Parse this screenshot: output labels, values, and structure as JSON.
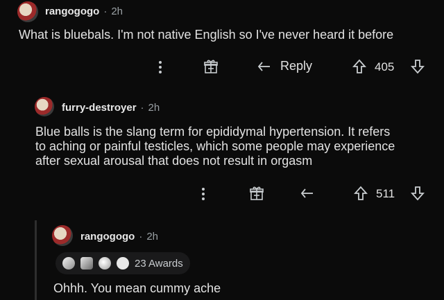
{
  "comments": [
    {
      "username": "rangogogo",
      "separator": "·",
      "time": "2h",
      "text": "What is bluebals. I'm not native English so I've never heard it before",
      "reply_label": "Reply",
      "votes": "405"
    },
    {
      "username": "furry-destroyer",
      "separator": "·",
      "time": "2h",
      "text_lines": [
        "Blue balls is the slang term for epididymal hypertension. It refers",
        "to aching or painful testicles, which some people may experience",
        "after sexual arousal that does not result in orgasm"
      ],
      "votes": "511"
    },
    {
      "username": "rangogogo",
      "separator": "·",
      "time": "2h",
      "awards_label": "23 Awards",
      "text": "Ohhh. You mean cummy ache"
    }
  ],
  "icons": {
    "more": "more-vertical-icon",
    "award": "gift-icon",
    "reply": "reply-arrow-icon",
    "upvote": "upvote-arrow-icon",
    "downvote": "downvote-arrow-icon"
  },
  "colors": {
    "background": "#0b0b0b",
    "text": "#e2e2e2",
    "muted": "#9aa0a4",
    "thread_line": "#2e2e2e"
  }
}
